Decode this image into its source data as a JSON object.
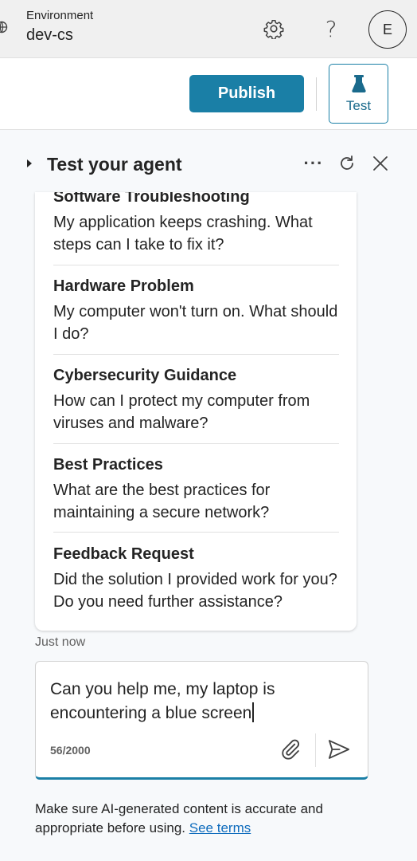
{
  "topbar": {
    "environment_label": "Environment",
    "environment_value": "dev-cs",
    "help_glyph": "?",
    "avatar_initial": "E"
  },
  "actions": {
    "publish_label": "Publish",
    "test_label": "Test"
  },
  "panel": {
    "title": "Test your agent",
    "more_glyph": "···"
  },
  "card": {
    "items": [
      {
        "title": "Software Troubleshooting",
        "description": "My application keeps crashing. What steps can I take to fix it?"
      },
      {
        "title": "Hardware Problem",
        "description": "My computer won't turn on. What should I do?"
      },
      {
        "title": "Cybersecurity Guidance",
        "description": "How can I protect my computer from viruses and malware?"
      },
      {
        "title": "Best Practices",
        "description": "What are the best practices for maintaining a secure network?"
      },
      {
        "title": "Feedback Request",
        "description": "Did the solution I provided work for you? Do you need further assistance?"
      }
    ]
  },
  "timestamp": "Just now",
  "input": {
    "value": "Can you help me, my laptop is encountering a blue screen",
    "counter": "56/2000"
  },
  "disclaimer": {
    "text": "Make sure AI-generated content is accurate and appropriate before using.",
    "link": "See terms"
  },
  "colors": {
    "accent": "#1a7fa6",
    "link": "#0f6cbd"
  },
  "icons": [
    "globe-icon",
    "gear-icon",
    "help-icon",
    "beaker-icon",
    "caret-right-icon",
    "more-icon",
    "refresh-icon",
    "close-icon",
    "attach-icon",
    "send-icon"
  ]
}
